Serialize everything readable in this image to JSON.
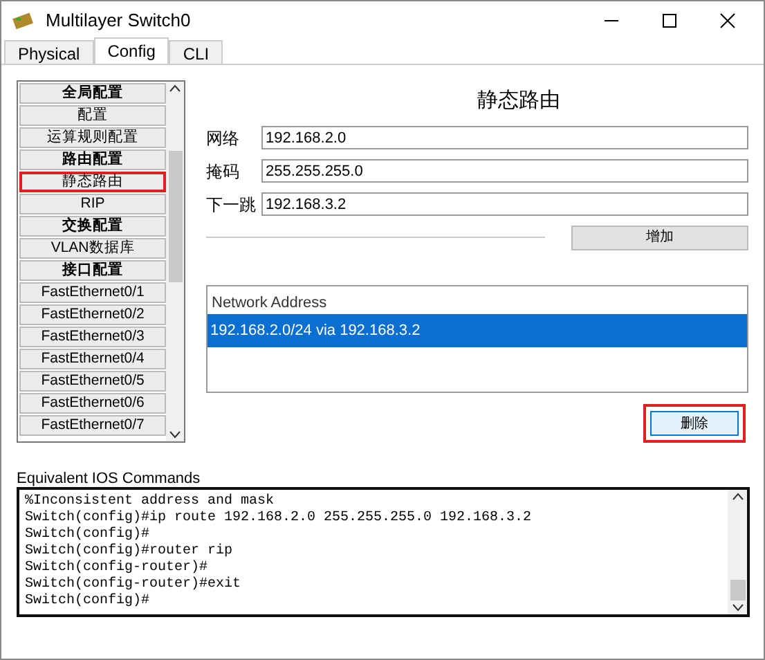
{
  "window": {
    "title": "Multilayer Switch0"
  },
  "tabs": [
    {
      "label": "Physical",
      "selected": false
    },
    {
      "label": "Config",
      "selected": true
    },
    {
      "label": "CLI",
      "selected": false
    }
  ],
  "sidebar": {
    "items": [
      {
        "kind": "header",
        "label": "全局配置",
        "annotated": false
      },
      {
        "kind": "item",
        "label": "配置",
        "annotated": false
      },
      {
        "kind": "item",
        "label": "运算规则配置",
        "annotated": false
      },
      {
        "kind": "header",
        "label": "路由配置",
        "annotated": false
      },
      {
        "kind": "item",
        "label": "静态路由",
        "annotated": true
      },
      {
        "kind": "item",
        "label": "RIP",
        "annotated": false
      },
      {
        "kind": "header",
        "label": "交换配置",
        "annotated": false
      },
      {
        "kind": "item",
        "label": "VLAN数据库",
        "annotated": false
      },
      {
        "kind": "header",
        "label": "接口配置",
        "annotated": false
      },
      {
        "kind": "item",
        "label": "FastEthernet0/1",
        "annotated": false
      },
      {
        "kind": "item",
        "label": "FastEthernet0/2",
        "annotated": false
      },
      {
        "kind": "item",
        "label": "FastEthernet0/3",
        "annotated": false
      },
      {
        "kind": "item",
        "label": "FastEthernet0/4",
        "annotated": false
      },
      {
        "kind": "item",
        "label": "FastEthernet0/5",
        "annotated": false
      },
      {
        "kind": "item",
        "label": "FastEthernet0/6",
        "annotated": false
      },
      {
        "kind": "item",
        "label": "FastEthernet0/7",
        "annotated": false
      }
    ]
  },
  "panel": {
    "title": "静态路由",
    "fields": [
      {
        "label": "网络",
        "value": "192.168.2.0"
      },
      {
        "label": "掩码",
        "value": "255.255.255.0"
      },
      {
        "label": "下一跳",
        "value": "192.168.3.2"
      }
    ],
    "add_button": {
      "label": "增加"
    },
    "routes": {
      "header": "Network Address",
      "rows": [
        {
          "text": "192.168.2.0/24 via 192.168.3.2",
          "selected": true
        }
      ]
    },
    "remove_button": {
      "label": "删除",
      "annotated": true
    }
  },
  "ios": {
    "label": "Equivalent IOS Commands",
    "lines": [
      "%Inconsistent address and mask",
      "Switch(config)#ip route 192.168.2.0 255.255.255.0 192.168.3.2",
      "Switch(config)#",
      "Switch(config)#router rip",
      "Switch(config-router)#",
      "Switch(config-router)#exit",
      "Switch(config)#"
    ]
  }
}
